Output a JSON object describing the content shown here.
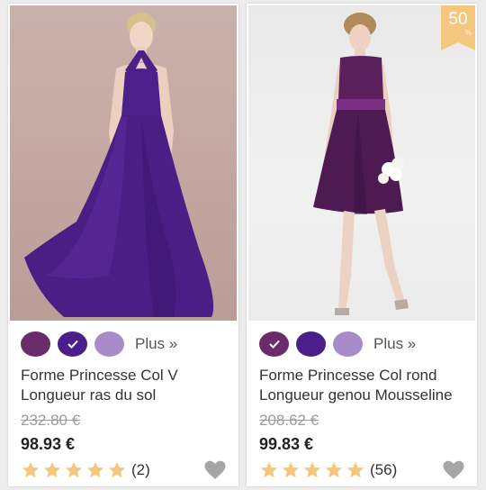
{
  "products": [
    {
      "swatch_colors": [
        "#6a2c6b",
        "#4a1f8a",
        "#a98bc9"
      ],
      "selected_swatch": 1,
      "more_label": "Plus »",
      "title": "Forme Princesse Col V Longueur ras du sol",
      "old_price": "232.80 €",
      "price": "98.93 €",
      "rating_stars": 5,
      "review_count": "(2)",
      "photo_icon": "purple-long-chiffon-dress-photo"
    },
    {
      "badge_number": "50",
      "badge_symbol": "%",
      "swatch_colors": [
        "#6a2c6b",
        "#4a1f8a",
        "#a98bc9"
      ],
      "selected_swatch": 0,
      "more_label": "Plus »",
      "title": "Forme Princesse Col rond Longueur genou Mousseline",
      "old_price": "208.62 €",
      "price": "99.83 €",
      "rating_stars": 5,
      "review_count": "(56)",
      "photo_icon": "purple-knee-length-dress-photo"
    }
  ],
  "colors": {
    "star": "#f5c77e",
    "heart": "#a6a6a6",
    "badge": "#f5c77e"
  }
}
